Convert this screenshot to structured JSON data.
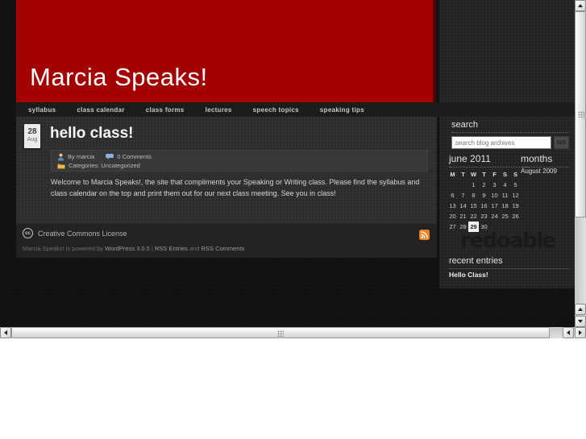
{
  "header": {
    "title": "Marcia Speaks!"
  },
  "nav": {
    "items": [
      "syllabus",
      "class calendar",
      "class forms",
      "lectures",
      "speech topics",
      "speaking tips"
    ]
  },
  "post": {
    "date_day": "28",
    "date_month": "Aug",
    "title": "hello class!",
    "author_label": "By marcia",
    "comments_label": "0 Comments",
    "categories_label": "Categories: Uncategorized",
    "body": "Welcome to Marcia Speaks!, the site that compliments your Speaking or Writing class. Please find the syllabus and class calendar on the top and print them out for our next class meeting. See you in class!"
  },
  "footer": {
    "cc_abbr": "cc",
    "cc_label": "Creative Commons License",
    "powered_prefix": "Marcia Speaks! is powered by",
    "wordpress_link": "WordPress 3.0.5",
    "separator": "|",
    "rss_entries_link": "RSS Entries",
    "and_text": "and",
    "rss_comments_link": "RSS Comments"
  },
  "sidebar": {
    "search_heading": "search",
    "search_placeholder": "search blog archives",
    "search_value": "",
    "go_label": "GO",
    "calendar": {
      "heading": "june 2011",
      "day_headers": [
        "M",
        "T",
        "W",
        "T",
        "F",
        "S",
        "S"
      ],
      "weeks": [
        [
          "",
          "",
          "1",
          "2",
          "3",
          "4",
          "5"
        ],
        [
          "6",
          "7",
          "8",
          "9",
          "10",
          "11",
          "12"
        ],
        [
          "13",
          "14",
          "15",
          "16",
          "17",
          "18",
          "19"
        ],
        [
          "20",
          "21",
          "22",
          "23",
          "24",
          "25",
          "26"
        ],
        [
          "27",
          "28",
          "29",
          "30",
          "",
          "",
          ""
        ]
      ],
      "today": "29"
    },
    "months_heading": "months",
    "months_items": [
      "August 2009"
    ],
    "theme_logo": "redoable",
    "recent_heading": "recent entries",
    "recent_items": [
      "Hello Class!"
    ]
  },
  "icons": {
    "author": "person-icon",
    "comments": "speech-bubble-icon",
    "categories": "folder-icon",
    "license": "cc-icon",
    "feed": "rss-icon"
  },
  "colors": {
    "header_red": "#a30000",
    "header_red_shadow": "#4f0404",
    "rss_orange": "#e8821e",
    "page_dark": "#232323"
  }
}
